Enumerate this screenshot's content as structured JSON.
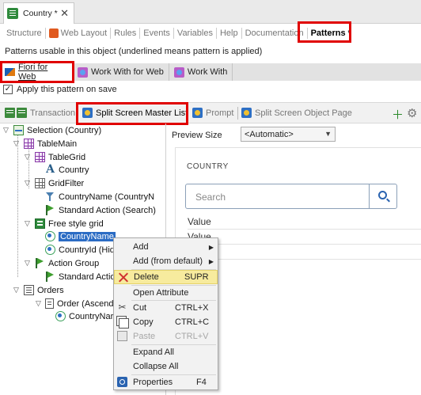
{
  "document_tab": {
    "title": "Country *",
    "close": "✕"
  },
  "editor_tabs": [
    "Structure",
    "Web Layout",
    "Rules",
    "Events",
    "Variables",
    "Help",
    "Documentation",
    "Patterns *"
  ],
  "info_text": "Patterns usable in this object (underlined means pattern is applied)",
  "pattern_tabs": [
    "Fiori for Web",
    "Work With for Web",
    "Work With"
  ],
  "apply_checkbox": {
    "label": "Apply this pattern on save",
    "checked": true
  },
  "toolbar": [
    "Transaction",
    "Split Screen Master List",
    "Prompt",
    "Split Screen Object Page"
  ],
  "tree": {
    "root": "Selection (Country)",
    "table_main": "TableMain",
    "table_grid": "TableGrid",
    "country": "Country",
    "grid_filter": "GridFilter",
    "country_name_filter": "CountryName (CountryN",
    "standard_action_search": "Standard Action (Search)",
    "free_style_grid": "Free style grid",
    "country_name": "CountryName",
    "country_id": "CountryId (Hid",
    "action_group": "Action Group",
    "standard_action": "Standard Actio",
    "orders": "Orders",
    "order": "Order (Ascend",
    "country_name_order": "CountryNar"
  },
  "preview": {
    "size_label": "Preview Size",
    "size_value": "<Automatic>",
    "header": "COUNTRY",
    "search_placeholder": "Search",
    "rows": [
      "Value",
      "Value"
    ]
  },
  "context_menu": [
    {
      "label": "Add",
      "shortcut": "",
      "submenu": true
    },
    {
      "label": "Add (from default)",
      "shortcut": "",
      "submenu": true
    },
    {
      "label": "Delete",
      "shortcut": "SUPR",
      "highlight": true
    },
    {
      "label": "Open Attribute",
      "shortcut": ""
    },
    {
      "label": "Cut",
      "shortcut": "CTRL+X"
    },
    {
      "label": "Copy",
      "shortcut": "CTRL+C"
    },
    {
      "label": "Paste",
      "shortcut": "CTRL+V",
      "disabled": true
    },
    {
      "label": "Expand All",
      "shortcut": ""
    },
    {
      "label": "Collapse All",
      "shortcut": ""
    },
    {
      "label": "Properties",
      "shortcut": "F4"
    }
  ],
  "colors": {
    "accent_red": "#e00000",
    "selection_blue": "#2b6cc4",
    "menu_highlight": "#f7eb9e"
  }
}
